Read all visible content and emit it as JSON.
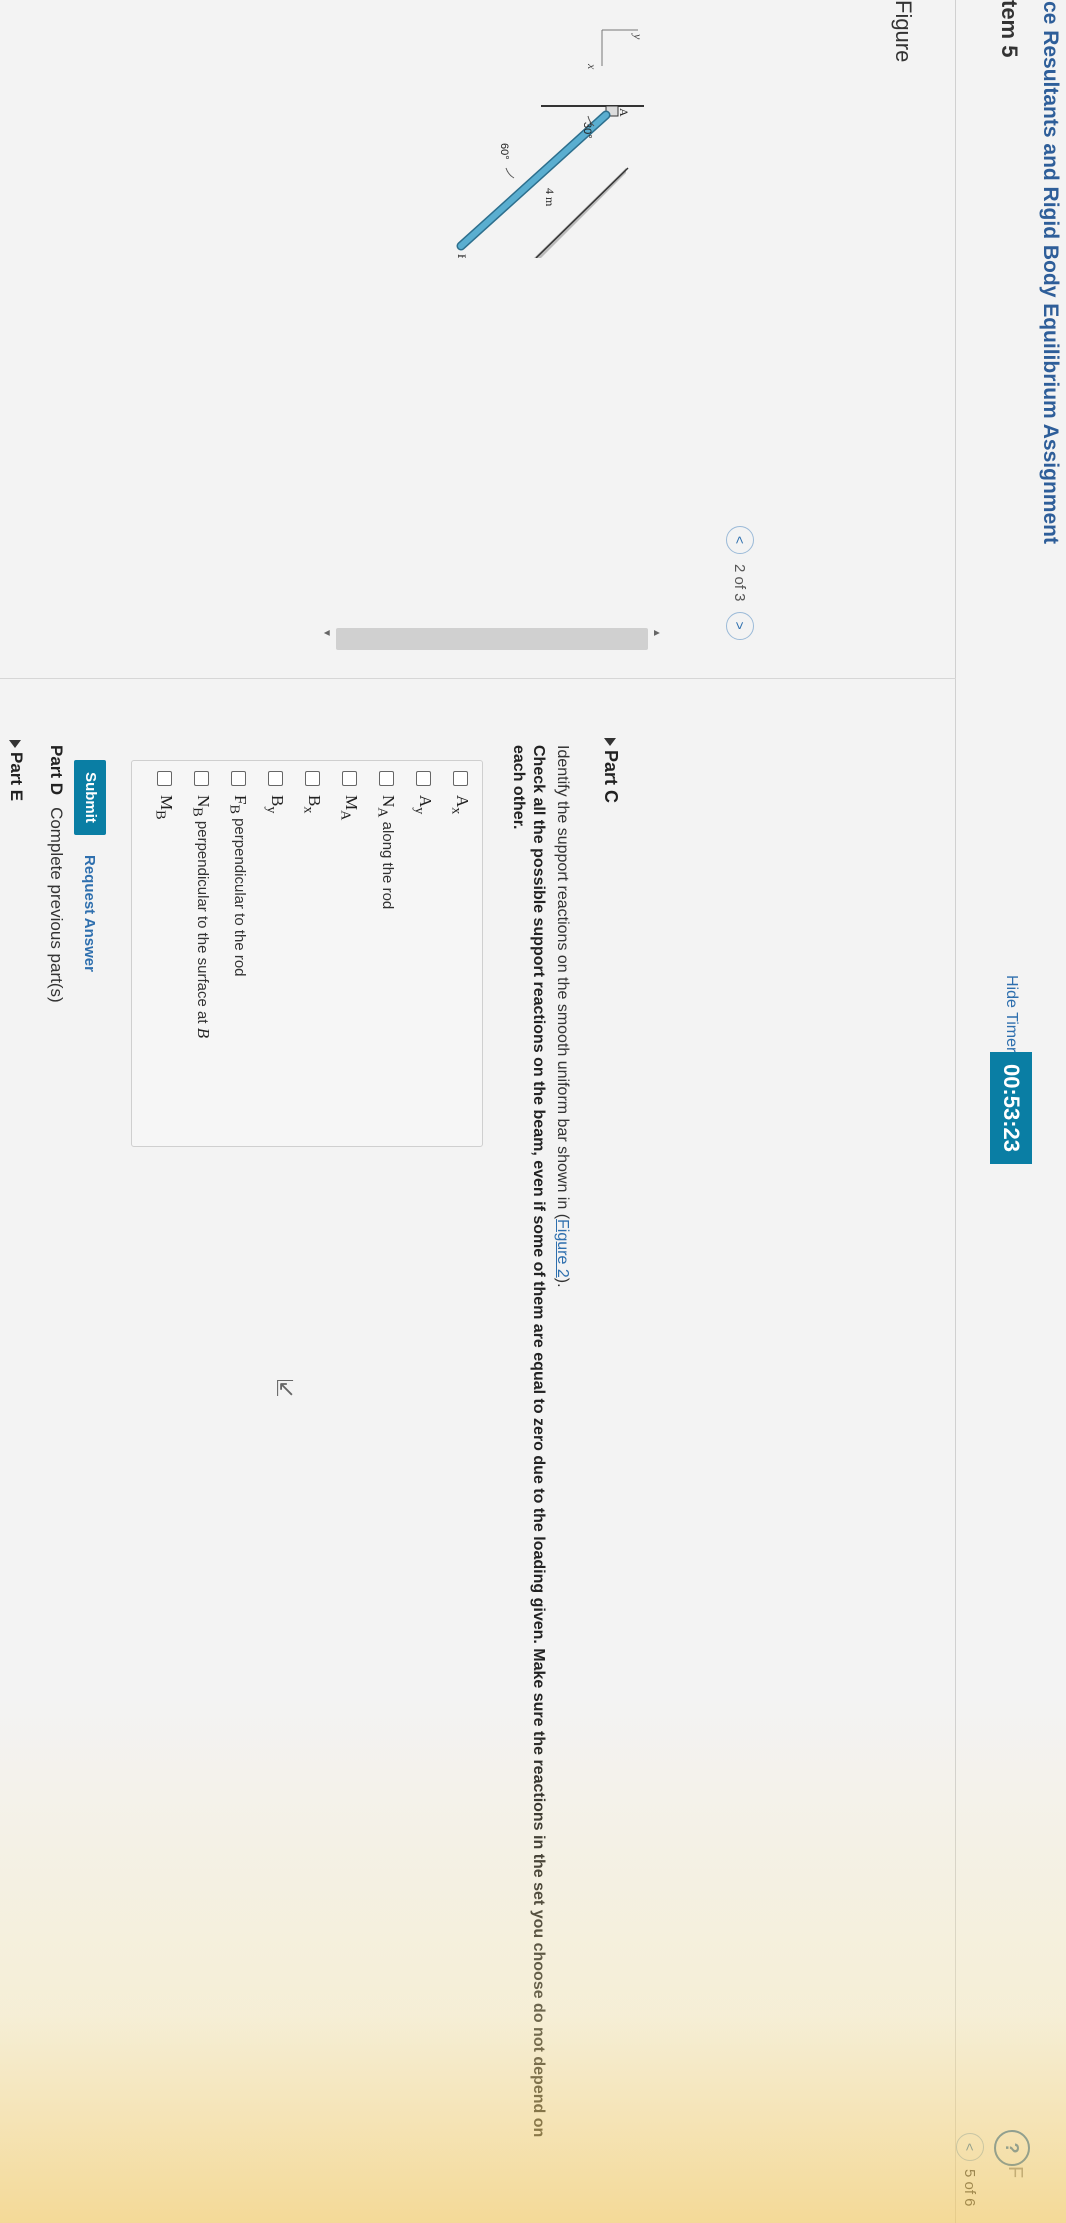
{
  "header": {
    "breadcrumb": "…ce Resultants and Rigid Body Equilibrium Assignment",
    "item_title": "tem 5",
    "hide_timer": "Hide Timer",
    "timer": "00:53:23",
    "help": "?",
    "help_trail": "F",
    "pager": "5 of 6"
  },
  "figure": {
    "label": "Figure",
    "pager": "2 of 3",
    "labels": {
      "axis_y": "y",
      "axis_x": "x",
      "point_a": "A",
      "point_b": "B",
      "angle_top": "30°",
      "angle_bottom": "60°",
      "length": "4 m"
    }
  },
  "part_c": {
    "title": "Part C",
    "question_prefix": "Identify the support reactions on the smooth uniform bar shown in (",
    "question_link": "Figure 2",
    "question_suffix": ").",
    "instructions": "Check all the possible support reactions on the beam, even if some of them are equal to zero due to the loading given. Make sure the reactions in the set you choose do not depend on each other.",
    "choices": [
      {
        "sym": "A",
        "sub": "x",
        "desc": ""
      },
      {
        "sym": "A",
        "sub": "y",
        "desc": ""
      },
      {
        "sym": "N",
        "sub": "A",
        "desc": " along the rod"
      },
      {
        "sym": "M",
        "sub": "A",
        "desc": ""
      },
      {
        "sym": "B",
        "sub": "x",
        "desc": ""
      },
      {
        "sym": "B",
        "sub": "y",
        "desc": ""
      },
      {
        "sym": "F",
        "sub": "B",
        "desc": " perpendicular to the rod"
      },
      {
        "sym": "N",
        "sub": "B",
        "desc": " perpendicular to the surface at "
      },
      {
        "sym": "M",
        "sub": "B",
        "desc": ""
      }
    ],
    "choice_tail_b": "B",
    "submit": "Submit",
    "request_answer": "Request Answer"
  },
  "part_d": {
    "title": "Part D",
    "status": "Complete previous part(s)"
  },
  "part_e": {
    "title": "Part E"
  },
  "colors": {
    "accent": "#0a7ea4",
    "link": "#2e6fae",
    "rod": "#5aaed0"
  }
}
